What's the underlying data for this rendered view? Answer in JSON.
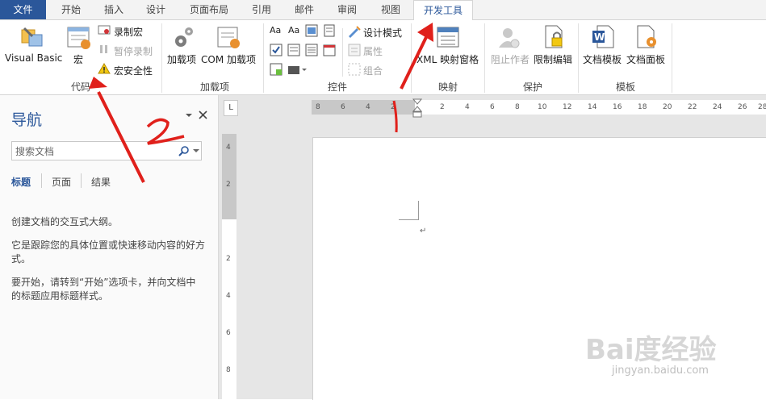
{
  "tabs": [
    "文件",
    "开始",
    "插入",
    "设计",
    "页面布局",
    "引用",
    "邮件",
    "审阅",
    "视图",
    "开发工具"
  ],
  "ribbon": {
    "code": {
      "visual_basic": "Visual Basic",
      "macros": "宏",
      "record_macro": "录制宏",
      "pause_recording": "暂停录制",
      "macro_security": "宏安全性",
      "group_label": "代码"
    },
    "addins": {
      "addins": "加载项",
      "com_addins": "COM 加载项",
      "group_label": "加载项"
    },
    "controls": {
      "design_mode": "设计模式",
      "properties": "属性",
      "group": "组合",
      "group_label": "控件"
    },
    "mapping": {
      "xml_mapping": "XML 映射窗格",
      "group_label": "映射"
    },
    "protect": {
      "block_authors": "阻止作者",
      "restrict_editing": "限制编辑",
      "group_label": "保护"
    },
    "templates": {
      "doc_template": "文档模板",
      "doc_panel": "文档面板",
      "group_label": "模板"
    }
  },
  "nav": {
    "title": "导航",
    "search_placeholder": "搜索文档",
    "tabs": [
      "标题",
      "页面",
      "结果"
    ],
    "text1": "创建文档的交互式大纲。",
    "text2": "它是跟踪您的具体位置或快速移动内容的好方式。",
    "text3": "要开始，请转到“开始”选项卡，并向文档中的标题应用标题样式。"
  },
  "ruler": {
    "corner": "L",
    "h_left": [
      "8",
      "6",
      "4",
      "2"
    ],
    "h_right": [
      "2",
      "4",
      "6",
      "8",
      "10",
      "12",
      "14",
      "16",
      "18",
      "20",
      "22",
      "24",
      "26",
      "28"
    ],
    "v_nums": [
      "4",
      "2",
      "2",
      "4",
      "6",
      "8"
    ]
  },
  "document": {
    "para_mark": "↵"
  },
  "annotations": {
    "one": "1",
    "two": "2"
  },
  "watermark": {
    "brand": "Bai度经验",
    "url": "jingyan.baidu.com"
  },
  "colors": {
    "accent": "#2b579a",
    "arrow": "#e0201b"
  }
}
